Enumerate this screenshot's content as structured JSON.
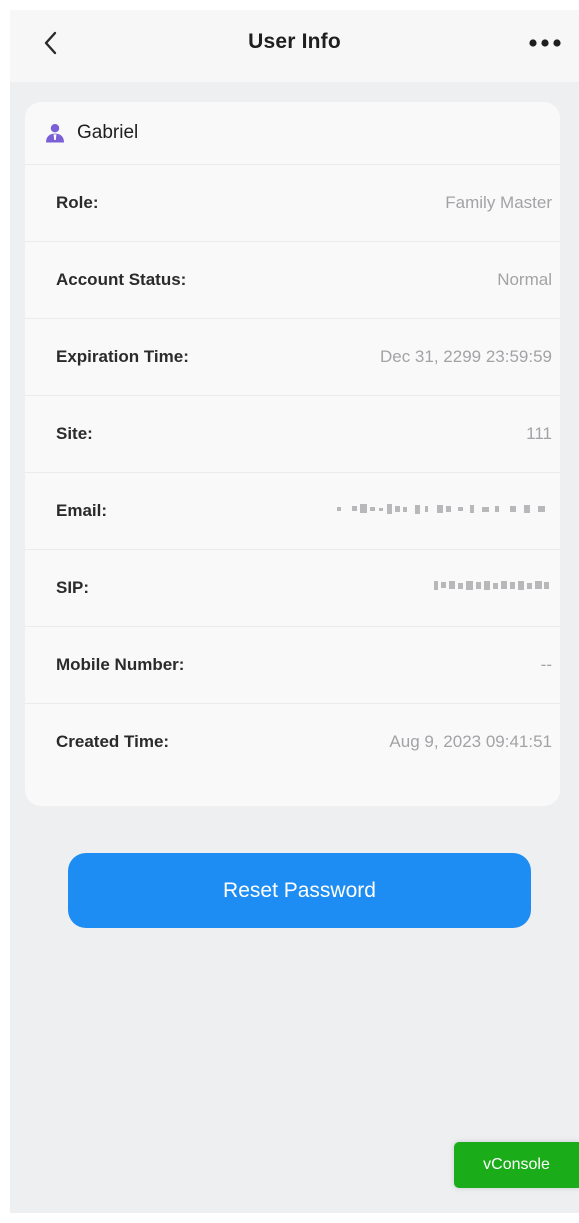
{
  "header": {
    "title": "User Info"
  },
  "user": {
    "name": "Gabriel"
  },
  "details": [
    {
      "label": "Role:",
      "value": "Family Master"
    },
    {
      "label": "Account Status:",
      "value": "Normal"
    },
    {
      "label": "Expiration Time:",
      "value": "Dec 31, 2299 23:59:59"
    },
    {
      "label": "Site:",
      "value": "111"
    },
    {
      "label": "Email:",
      "value": ""
    },
    {
      "label": "SIP:",
      "value": ""
    },
    {
      "label": "Mobile Number:",
      "value": "--"
    },
    {
      "label": "Created Time:",
      "value": "Aug 9, 2023 09:41:51"
    }
  ],
  "actions": {
    "reset_password": "Reset Password"
  },
  "debug": {
    "vconsole": "vConsole"
  },
  "icons": {
    "back": "chevron-left-icon",
    "more": "more-horizontal-icon",
    "user": "user-icon"
  },
  "colors": {
    "accent": "#1d8cf3",
    "vconsole": "#1aad19",
    "user_icon": "#7b5fd6"
  }
}
